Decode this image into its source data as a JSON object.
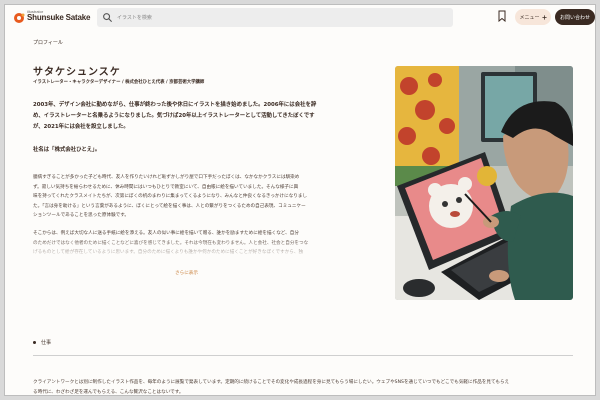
{
  "header": {
    "brand_top": "illustrator",
    "brand_name": "Shunsuke Satake",
    "search_placeholder": "イラストを検索",
    "menu_label": "メニュー",
    "contact_label": "お問い合わせ"
  },
  "colors": {
    "accent": "#3a2a22",
    "link": "#c9813d",
    "menu_bg": "#f7e6da",
    "logo_orange": "#e85a1e"
  },
  "main": {
    "breadcrumb": "プロフィール",
    "name": "サタケシュンスケ",
    "title_line": "イラストレーター・キャラクターデザイナー / 株式会社ひとえ代表 / 京都芸術大学講師",
    "intro": [
      "2003年、デザイン会社に勤めながら、仕事が終わった後や休日にイラストを描き始めました。2006年には会社を辞",
      "め、イラストレーターと名乗るようになりました。気づけば20年以上イラストレーターとして活動してきたぼくです",
      "が、2021年には会社を設立しました。"
    ],
    "company": "社名は「株式会社ひとえ」。",
    "story": [
      "臆病すぎることが多かった子ども時代、友人を作りたいけれど恥ずかしがり屋で口下手だったぼくは、なかなかクラスには馴染め",
      "ず。寂しい気持ちを紛らわせるために、休み時間にはいつもひとりで教室にいて、自由帳に絵を描いていました。そんな様子に興",
      "味を持ってくれたクラスメイトたちが、次第にぼくの机のまわりに集まってくるようになり、みんなと仲良くなるきっかけになりまし",
      "た。「言は身を助ける」という言葉があるように、ぼくにとって絵を描く事は、人との繋がりをつくるための自己表現、コミュニケー",
      "ションツールであることを思った原体験です。"
    ],
    "story2": [
      "そこからは、例えば大切な人に送る手紙に絵を添える。友人の似い事に絵を描いて贈る、誰かを励ますために絵を描くなど、自分",
      "のためだけではなく他者のために描くことなどに喜びを感じてきました。それは今現在も変わりません。人と会社、社会と自分をつな",
      "げるものとして絵が存在しているように思います。自分のために描くよりも誰かや何かのために描くことが好きなぼくですから、独"
    ],
    "more_label": "さらに表示"
  },
  "career": {
    "heading": "仕事",
    "text": [
      "クライアントワークとは別に制作したイラスト作品を、毎年のように展覧で発表しています。定期的に続けることでその変化や成長過程を身に見てもらう場にしたい。ウェブやSNSを通じていつでもどこでも気軽に作品を見てもらえ",
      "る時代に、わざわざ足を運んでもらえる、こんな贅沢なことはないです。"
    ]
  }
}
